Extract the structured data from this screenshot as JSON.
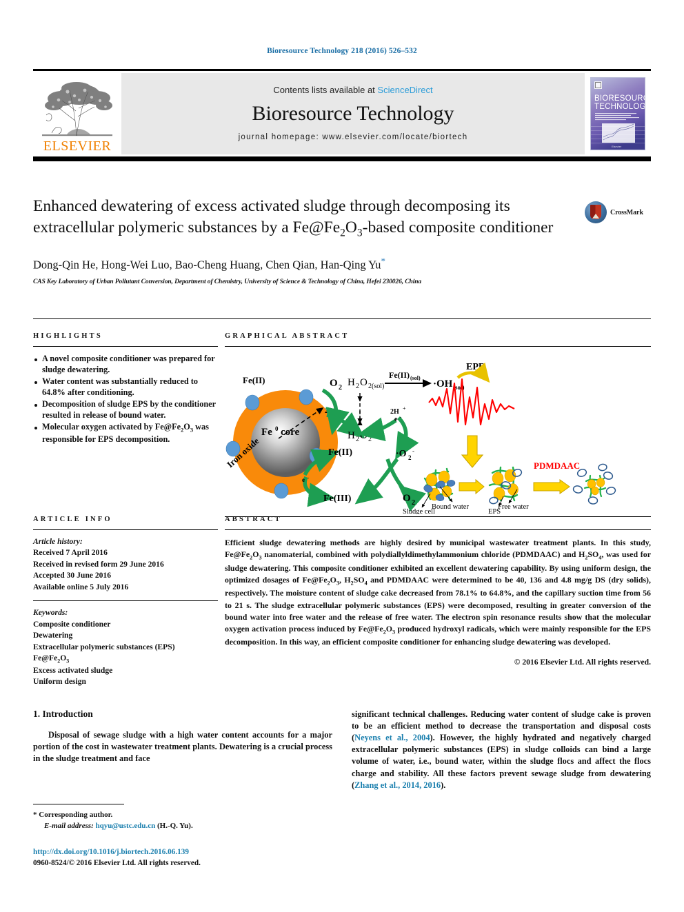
{
  "running_head": "Bioresource Technology 218 (2016) 526–532",
  "masthead": {
    "publisher_name": "ELSEVIER",
    "contents_prefix": "Contents lists available at",
    "contents_link": "ScienceDirect",
    "journal_name": "Bioresource Technology",
    "homepage_line": "journal homepage: www.elsevier.com/locate/biortech",
    "cover_title_line1": "BIORESOURCE",
    "cover_title_line2": "TECHNOLOGY"
  },
  "article": {
    "title_html": "Enhanced dewatering of excess activated sludge through decomposing its extracellular polymeric substances by a Fe@Fe<sub>2</sub>O<sub>3</sub>-based composite conditioner",
    "crossmark_label": "CrossMark",
    "authors": "Dong-Qin He, Hong-Wei Luo, Bao-Cheng Huang, Chen Qian, Han-Qing Yu",
    "corresponding_marker": "*",
    "affiliation": "CAS Key Laboratory of Urban Pollutant Conversion, Department of Chemistry, University of Science & Technology of China, Hefei 230026, China"
  },
  "highlights": {
    "heading": "HIGHLIGHTS",
    "items_html": [
      "A novel composite conditioner was prepared for sludge dewatering.",
      "Water content was substantially reduced to 64.8% after conditioning.",
      "Decomposition of sludge EPS by the conditioner resulted in release of bound water.",
      "Molecular oxygen activated by Fe@Fe<sub>2</sub>O<sub>3</sub> was responsible for EPS decomposition."
    ]
  },
  "graphical_abstract": {
    "heading": "GRAPHICAL ABSTRACT",
    "labels": {
      "fe2_top": "Fe(II)",
      "core": "Fe⁰ core",
      "iron_oxide": "Iron oxide",
      "o2_top": "O",
      "o2_top_sub": "2",
      "two_e": "2e",
      "h2o2_sol": "H O",
      "h2o2_sol_full": "H2O2(sol)",
      "h2o2": "H2O2",
      "fe2_sol": "Fe(II)(sol)",
      "oh_sol": "·OH(sol)",
      "epr": "EPR",
      "two_h": "2H",
      "e_minus": "e",
      "fe2_mid": "Fe(II)",
      "fe3": "Fe(III)",
      "superoxide": "·O2",
      "o2_bottom": "O2",
      "pdmdaac": "PDMDAAC",
      "bound_water": "Bound water",
      "free_water": "Free water",
      "sludge_cell": "Sludge cell",
      "eps": "EPS"
    },
    "colors": {
      "iron_oxide_shell": "#F98A0A",
      "fe_core": "#7d7d7d",
      "fe2_dot": "#5b9bd5",
      "arrow_green": "#1e9e52",
      "epr_red": "#ff0000",
      "epr_yellow": "#ffd400",
      "pdmdaac_red": "#ff0000",
      "floc_green": "#22b14c",
      "cell_orange": "#ffc000",
      "water_blue": "#4a7ebb"
    }
  },
  "article_info": {
    "heading": "ARTICLE INFO",
    "history_label": "Article history:",
    "history": [
      "Received 7 April 2016",
      "Received in revised form 29 June 2016",
      "Accepted 30 June 2016",
      "Available online 5 July 2016"
    ],
    "keywords_label": "Keywords:",
    "keywords_html": [
      "Composite conditioner",
      "Dewatering",
      "Extracellular polymeric substances (EPS)",
      "Fe@Fe<sub>2</sub>O<sub>3</sub>",
      "Excess activated sludge",
      "Uniform design"
    ]
  },
  "abstract": {
    "heading": "ABSTRACT",
    "text_html": "Efficient sludge dewatering methods are highly desired by municipal wastewater treatment plants. In this study, Fe@Fe<sub>2</sub>O<sub>3</sub> nanomaterial, combined with polydiallyldimethylammonium chloride (PDMDAAC) and H<sub>2</sub>SO<sub>4</sub>, was used for sludge dewatering. This composite conditioner exhibited an excellent dewatering capability. By using uniform design, the optimized dosages of Fe@Fe<sub>2</sub>O<sub>3</sub>, H<sub>2</sub>SO<sub>4</sub> and PDMDAAC were determined to be 40, 136 and 4.8 mg/g DS (dry solids), respectively. The moisture content of sludge cake decreased from 78.1% to 64.8%, and the capillary suction time from 56 to 21 s. The sludge extracellular polymeric substances (EPS) were decomposed, resulting in greater conversion of the bound water into free water and the release of free water. The electron spin resonance results show that the molecular oxygen activation process induced by Fe@Fe<sub>2</sub>O<sub>3</sub> produced hydroxyl radicals, which were mainly responsible for the EPS decomposition. In this way, an efficient composite conditioner for enhancing sludge dewatering was developed.",
    "copyright": "© 2016 Elsevier Ltd. All rights reserved."
  },
  "body": {
    "section_title": "1. Introduction",
    "paragraph_left": "Disposal of sewage sludge with a high water content accounts for a major portion of the cost in wastewater treatment plants. Dewatering is a crucial process in the sludge treatment and face",
    "paragraph_right_part1": "significant technical challenges. Reducing water content of sludge cake is proven to be an efficient method to decrease the transportation and disposal costs (",
    "citation_1": "Neyens et al., 2004",
    "paragraph_right_part2": "). However, the highly hydrated and negatively charged extracellular polymeric substances (EPS) in sludge colloids can bind a large volume of water, i.e., bound water, within the sludge flocs and affect the flocs charge and stability. All these factors prevent sewage sludge from dewatering (",
    "citation_2": "Zhang et al., 2014, 2016",
    "paragraph_right_part3": ")."
  },
  "footer": {
    "corresponding_marker": "*",
    "corresponding_label": "Corresponding author.",
    "email_label": "E-mail address:",
    "email": "hqyu@ustc.edu.cn",
    "email_suffix": "(H.-Q. Yu).",
    "doi_url": "http://dx.doi.org/10.1016/j.biortech.2016.06.139",
    "issn_line": "0960-8524/© 2016 Elsevier Ltd. All rights reserved."
  },
  "colors": {
    "link_blue": "#1a7fae",
    "sciencedirect_blue": "#2b9cd8",
    "elsevier_orange": "#f08000",
    "masthead_gray": "#e8e8e8"
  }
}
